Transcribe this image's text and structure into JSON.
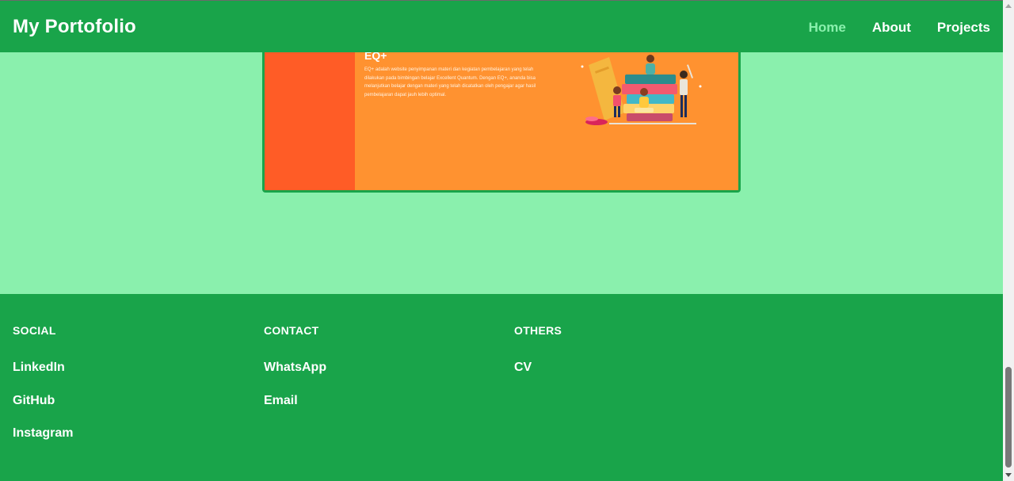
{
  "navbar": {
    "brand": "My Portofolio",
    "links": [
      {
        "label": "Home",
        "active": true
      },
      {
        "label": "About",
        "active": false
      },
      {
        "label": "Projects",
        "active": false
      }
    ]
  },
  "project": {
    "image_title": "EQ+",
    "image_description": "EQ+ adalah website penyimpanan materi dan kegiatan pembelajaran yang telah dilakukan pada bimbingan belajar Excellent Quantum. Dengan EQ+, ananda bisa melanjutkan belajar dengan materi yang telah dicatatkan oleh pengajar agar hasil pembelajaran dapat jauh lebih optimal."
  },
  "footer": {
    "social": {
      "heading": "SOCIAL",
      "links": [
        "LinkedIn",
        "GitHub",
        "Instagram"
      ]
    },
    "contact": {
      "heading": "CONTACT",
      "links": [
        "WhatsApp",
        "Email"
      ]
    },
    "others": {
      "heading": "OTHERS",
      "links": [
        "CV"
      ]
    }
  },
  "colors": {
    "primary_green": "#19a44a",
    "light_green": "#8af0ad",
    "orange": "#ff9230",
    "red_orange": "#ff5c26"
  }
}
